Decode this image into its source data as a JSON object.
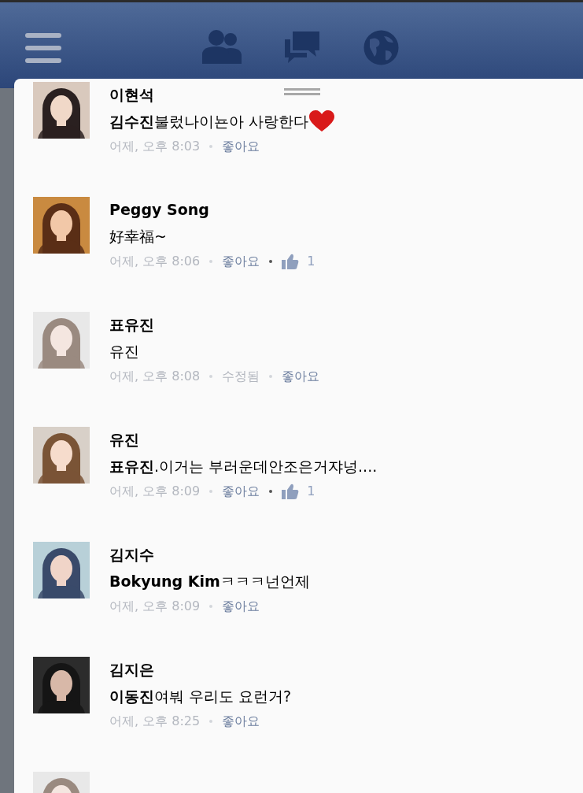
{
  "top_bar": {
    "buttons": [
      {
        "kind": "menu"
      },
      {
        "kind": "friends"
      },
      {
        "kind": "messages"
      },
      {
        "kind": "notifications"
      }
    ]
  },
  "comments": [
    {
      "author": "이현석",
      "text": "**김수진**불렀나이뇬아 사랑한다",
      "heart": true,
      "time": "어제, 오후 8:03",
      "like_label": "좋아요"
    },
    {
      "author": "Peggy Song",
      "text": "好幸福~",
      "heart": false,
      "time": "어제, 오후 8:06",
      "like_label": "좋아요",
      "like_count": "1"
    },
    {
      "author": "표유진",
      "text": "유진",
      "heart": false,
      "time": "어제, 오후 8:08",
      "edited_label": "수정됨",
      "like_label": "좋아요"
    },
    {
      "author": "유진",
      "text": "**표유진**.이거는 부러운데안조은거쟈넝....",
      "heart": false,
      "time": "어제, 오후 8:09",
      "like_label": "좋아요",
      "like_count": "1"
    },
    {
      "author": "김지수",
      "text": "**Bokyung Kim**ㅋㅋㅋ넌언제",
      "heart": false,
      "time": "어제, 오후 8:09",
      "like_label": "좋아요"
    },
    {
      "author": "김지은",
      "text": "**이동진**여붜 우리도 요런거?",
      "heart": false,
      "time": "어제, 오후 8:25",
      "like_label": "좋아요"
    }
  ]
}
